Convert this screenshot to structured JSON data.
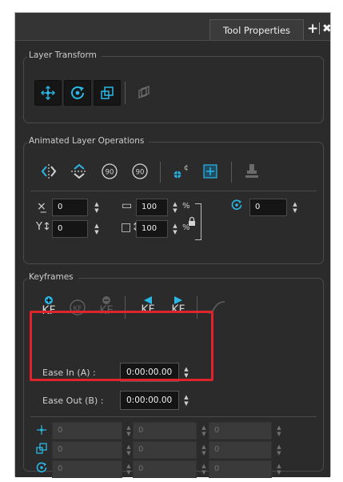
{
  "tab": {
    "title": "Tool Properties",
    "add": "+",
    "close": "✖"
  },
  "layer_transform": {
    "title": "Layer Transform"
  },
  "animated_ops": {
    "title": "Animated Layer Operations",
    "x_value": "0",
    "y_value": "0",
    "width_value": "100",
    "height_value": "100",
    "percent_w": "%",
    "percent_h": "%",
    "rotation_value": "0",
    "rot_neg90": "90",
    "rot_pos90": "90"
  },
  "keyframes": {
    "title": "Keyframes",
    "kf_label": "KF",
    "ease_in_label": "Ease In (A) :",
    "ease_in_value": "0:00:00.00",
    "ease_out_label": "Ease Out (B) :",
    "ease_out_value": "0:00:00.00",
    "disabled_rows": [
      {
        "v1": "0",
        "v2": "0",
        "v3": "0"
      },
      {
        "v1": "0",
        "v2": "0",
        "v3": "0"
      },
      {
        "v1": "0",
        "v2": "0",
        "v3": "0"
      }
    ]
  },
  "colors": {
    "accent": "#2bb7e6",
    "highlight": "#e0242b",
    "panel": "#2b2b2b"
  }
}
